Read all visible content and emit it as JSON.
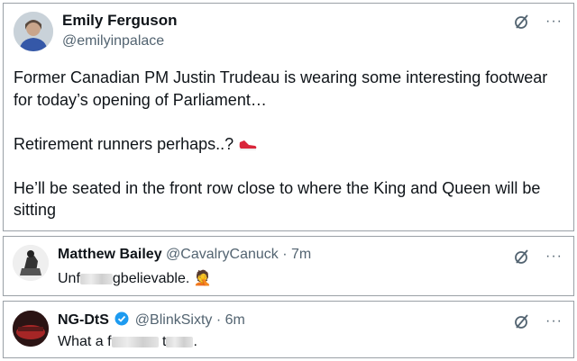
{
  "main_post": {
    "name": "Emily Ferguson",
    "handle": "@emilyinpalace",
    "paragraphs": [
      "Former Canadian PM Justin Trudeau is wearing some interesting footwear for today’s opening of Parliament…",
      "Retirement runners perhaps..?",
      "He’ll be seated in the front row close to where the King and Queen will be sitting"
    ],
    "more_label": "···"
  },
  "reply1": {
    "name": "Matthew Bailey",
    "handle": "@CavalryCanuck",
    "time": " · 7m",
    "text_before": "Unf",
    "text_after": "gbelievable.",
    "emoji": "🤦",
    "more_label": "···"
  },
  "reply2": {
    "name": "NG-DtS",
    "handle": "@BlinkSixty",
    "time": " · 6m",
    "text_before": "What a f",
    "text_mid": " t",
    "text_after": ".",
    "more_label": "···"
  },
  "colors": {
    "text": "#0f1419",
    "muted": "#536471",
    "verified": "#1d9bf0",
    "shoe": "#d9253a"
  },
  "icons": [
    "grok-icon",
    "more-icon",
    "shoe-emoji-icon",
    "verified-badge-icon",
    "facepalm-emoji-icon"
  ]
}
